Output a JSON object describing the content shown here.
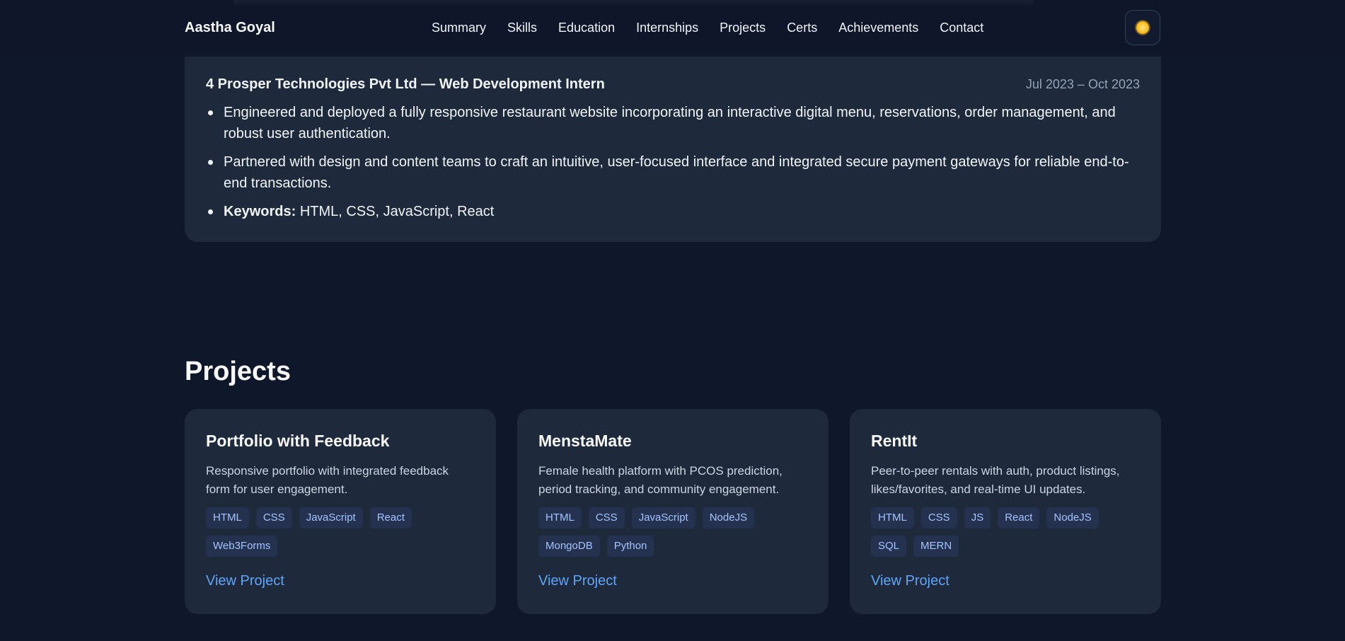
{
  "nav": {
    "brand": "Aastha Goyal",
    "links": [
      "Summary",
      "Skills",
      "Education",
      "Internships",
      "Projects",
      "Certs",
      "Achievements",
      "Contact"
    ],
    "theme_icon": "sun-icon"
  },
  "internship": {
    "title": "4 Prosper Technologies Pvt Ltd — Web Development Intern",
    "date": "Jul 2023 – Oct 2023",
    "bullets": [
      "Engineered and deployed a fully responsive restaurant website incorporating an interactive digital menu, reservations, order management, and robust user authentication.",
      "Partnered with design and content teams to craft an intuitive, user-focused interface and integrated secure payment gateways for reliable end-to-end transactions."
    ],
    "keywords_label": "Keywords:",
    "keywords": "HTML, CSS, JavaScript, React"
  },
  "projects": {
    "heading": "Projects",
    "items": [
      {
        "name": "Portfolio with Feedback",
        "description": "Responsive portfolio with integrated feedback form for user engagement.",
        "tags": [
          "HTML",
          "CSS",
          "JavaScript",
          "React",
          "Web3Forms"
        ],
        "link_label": "View Project"
      },
      {
        "name": "MenstaMate",
        "description": "Female health platform with PCOS prediction, period tracking, and community engagement.",
        "tags": [
          "HTML",
          "CSS",
          "JavaScript",
          "NodeJS",
          "MongoDB",
          "Python"
        ],
        "link_label": "View Project"
      },
      {
        "name": "RentIt",
        "description": "Peer-to-peer rentals with auth, product listings, likes/favorites, and real-time UI updates.",
        "tags": [
          "HTML",
          "CSS",
          "JS",
          "React",
          "NodeJS",
          "SQL",
          "MERN"
        ],
        "link_label": "View Project"
      }
    ]
  },
  "colors": {
    "background": "#0f172a",
    "card": "#1e293b",
    "accent_link": "#60a5fa",
    "tag_bg": "#24324f",
    "tag_text": "#a5c3ff"
  }
}
